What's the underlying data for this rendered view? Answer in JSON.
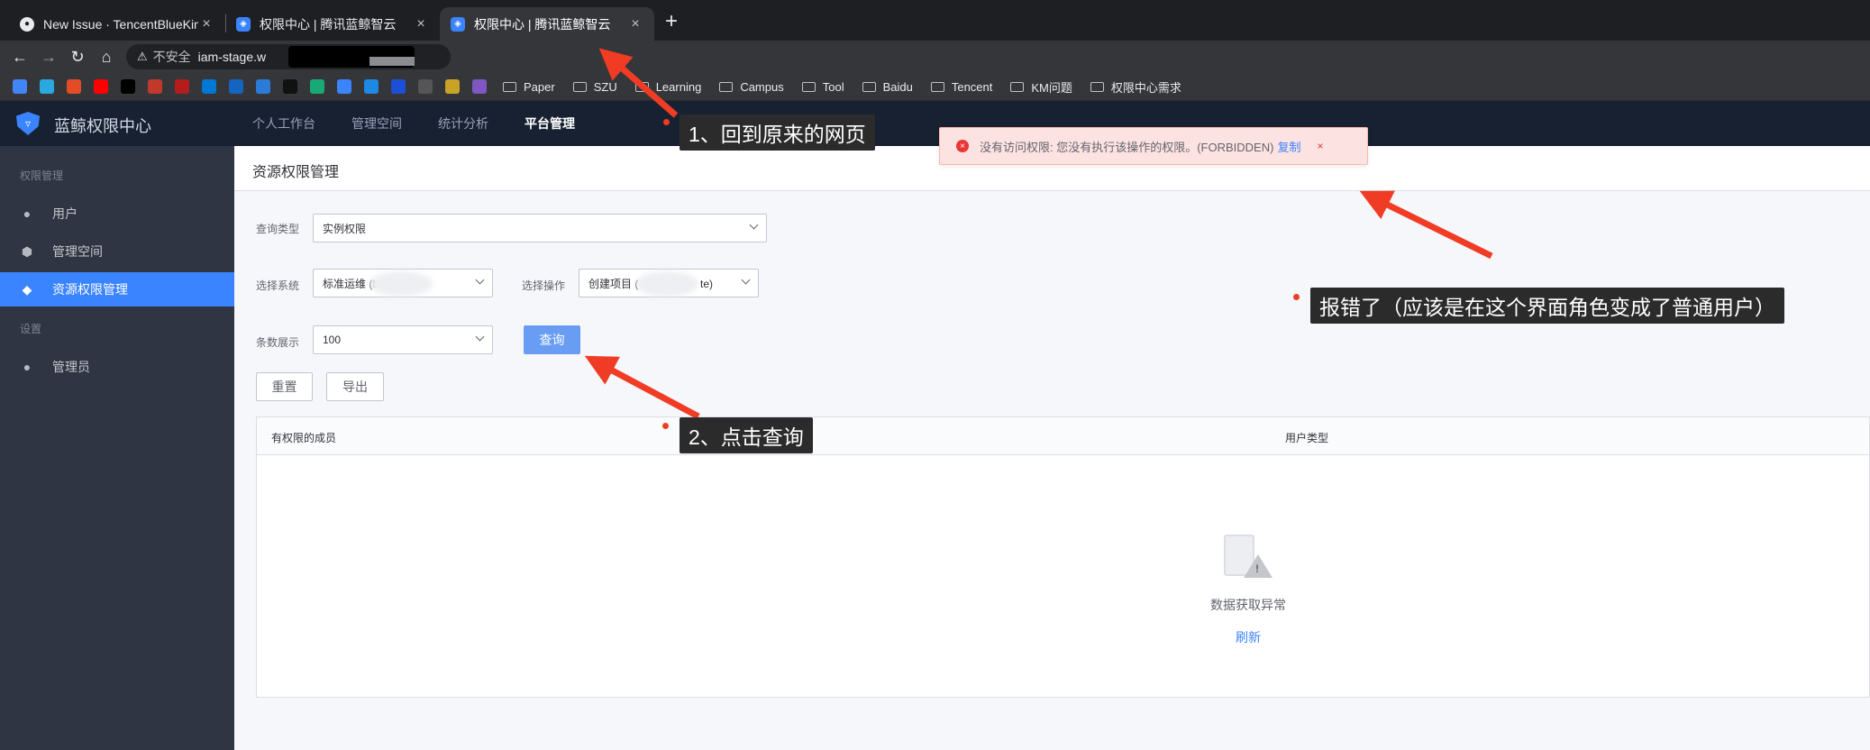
{
  "browser": {
    "tabs": [
      {
        "title": "New Issue · TencentBlueKing/b",
        "icon": "github-icon"
      },
      {
        "title": "权限中心 | 腾讯蓝鲸智云",
        "icon": "bk-shield-icon"
      },
      {
        "title": "权限中心 | 腾讯蓝鲸智云",
        "icon": "bk-shield-icon"
      }
    ],
    "address": {
      "security": "不安全",
      "url": "iam-stage.w"
    },
    "bookmarks": [
      "Paper",
      "SZU",
      "Learning",
      "Campus",
      "Tool",
      "Baidu",
      "Tencent",
      "KM问题",
      "权限中心需求"
    ],
    "bookmark_icon_colors": [
      "#4285f4",
      "#2aa8e0",
      "#e34c26",
      "#ff0000",
      "#000000",
      "#c0392b",
      "#b71c1c",
      "#0078d4",
      "#1565c0",
      "#2b7bd8",
      "#111111",
      "#19a974",
      "#3a84ff",
      "#1e88e5",
      "#1d4ed8",
      "#555555",
      "#c9a227",
      "#7e57c2"
    ]
  },
  "app": {
    "logo_text": "蓝鲸权限中心",
    "nav": [
      "个人工作台",
      "管理空间",
      "统计分析",
      "平台管理"
    ],
    "sidebar": {
      "group1": "权限管理",
      "items1": [
        {
          "label": "用户",
          "icon": "user-icon"
        },
        {
          "label": "管理空间",
          "icon": "cube-icon"
        },
        {
          "label": "资源权限管理",
          "icon": "shield-icon"
        }
      ],
      "group2": "设置",
      "items2": [
        {
          "label": "管理员",
          "icon": "admin-icon"
        }
      ]
    },
    "page_title": "资源权限管理",
    "form": {
      "query_type_label": "查询类型",
      "query_type_value": "实例权限",
      "system_label": "选择系统",
      "system_value": "标准运维 (b",
      "action_label": "选择操作",
      "action_value_a": "创建项目 (",
      "action_value_b": "te)",
      "count_label": "条数展示",
      "count_value": "100",
      "query_button": "查询",
      "reset_button": "重置",
      "export_button": "导出"
    },
    "table": {
      "columns": [
        "有权限的成员",
        "用户类型"
      ],
      "empty_text": "数据获取异常",
      "refresh": "刷新"
    },
    "toast": {
      "message": "没有访问权限: 您没有执行该操作的权限。(FORBIDDEN)",
      "copy": "复制",
      "close": "×"
    }
  },
  "annotations": {
    "step1": "1、回到原来的网页",
    "step2": "2、点击查询",
    "error_note": "报错了（应该是在这个界面角色变成了普通用户）",
    "color": "#f03c24"
  }
}
